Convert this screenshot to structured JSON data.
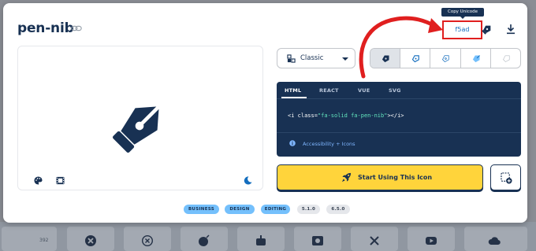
{
  "icon": {
    "name": "pen-nib",
    "unicode": "f5ad"
  },
  "header": {
    "copy_tooltip": "Copy Unicode"
  },
  "style_select": {
    "selected": "Classic"
  },
  "code": {
    "tabs": [
      "HTML",
      "REACT",
      "VUE",
      "SVG"
    ],
    "active_tab": "HTML",
    "snippet_open": "<i class=",
    "snippet_class": "\"fa-solid fa-pen-nib\"",
    "snippet_close": "></i>",
    "accessibility_label": "Accessibility + Icons"
  },
  "cta": {
    "label": "Start Using This Icon"
  },
  "tags": {
    "categories": [
      "BUSINESS",
      "DESIGN",
      "EDITING"
    ],
    "versions": [
      "5.1.0",
      "6.5.0"
    ]
  },
  "background": {
    "count": "392"
  },
  "colors": {
    "navy": "#183153",
    "accent_yellow": "#ffd43b",
    "tag_blue": "#74c0fc",
    "annotation_red": "#e01f1f",
    "code_green": "#63e6be"
  }
}
